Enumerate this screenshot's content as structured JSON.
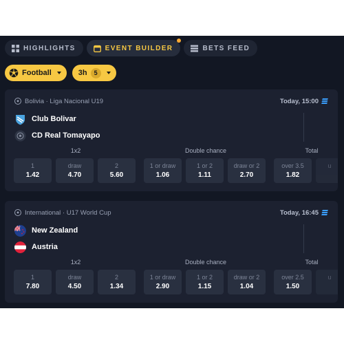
{
  "tabs": [
    {
      "label": "HIGHLIGHTS",
      "icon": "grid-icon"
    },
    {
      "label": "EVENT BUILDER",
      "icon": "calendar-icon"
    },
    {
      "label": "BETS FEED",
      "icon": "list-icon"
    }
  ],
  "filters": {
    "sport": "Football",
    "time_window": "3h",
    "time_count": "5"
  },
  "colors": {
    "accent": "#f7c843",
    "background": "#121723",
    "card": "#1c2130",
    "odds_button": "#293040",
    "stream_icon": "#3aa0ff"
  },
  "events": [
    {
      "league": "Bolivia · Liga Nacional U19",
      "time": "Today, 15:00",
      "home": "Club Bolivar",
      "away": "CD Real Tomayapo",
      "markets": {
        "m1": "1x2",
        "m2": "Double chance",
        "m3": "Total"
      },
      "odds": [
        {
          "label": "1",
          "value": "1.42"
        },
        {
          "label": "draw",
          "value": "4.70"
        },
        {
          "label": "2",
          "value": "5.60"
        },
        {
          "label": "1 or draw",
          "value": "1.06"
        },
        {
          "label": "1 or 2",
          "value": "1.11"
        },
        {
          "label": "draw or 2",
          "value": "2.70"
        },
        {
          "label": "over 3.5",
          "value": "1.82"
        },
        {
          "label": "u",
          "value": ""
        }
      ]
    },
    {
      "league": "International · U17 World Cup",
      "time": "Today, 16:45",
      "home": "New Zealand",
      "away": "Austria",
      "markets": {
        "m1": "1x2",
        "m2": "Double chance",
        "m3": "Total"
      },
      "odds": [
        {
          "label": "1",
          "value": "7.80"
        },
        {
          "label": "draw",
          "value": "4.50"
        },
        {
          "label": "2",
          "value": "1.34"
        },
        {
          "label": "1 or draw",
          "value": "2.90"
        },
        {
          "label": "1 or 2",
          "value": "1.15"
        },
        {
          "label": "draw or 2",
          "value": "1.04"
        },
        {
          "label": "over 2.5",
          "value": "1.50"
        },
        {
          "label": "u",
          "value": ""
        }
      ]
    }
  ]
}
